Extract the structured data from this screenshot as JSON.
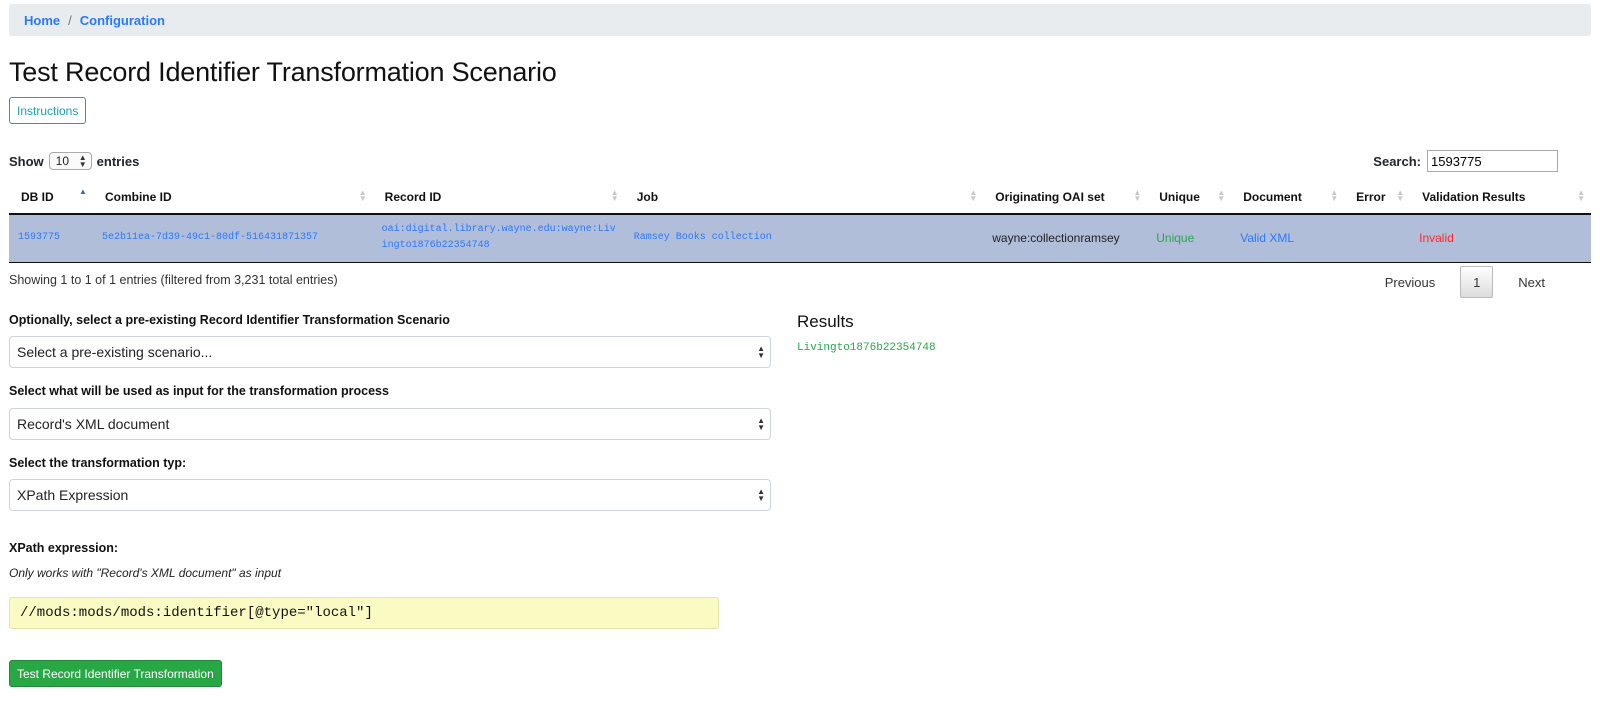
{
  "breadcrumb": {
    "items": [
      "Home",
      "Configuration"
    ],
    "separator": "/"
  },
  "page": {
    "title": "Test Record Identifier Transformation Scenario"
  },
  "instructions_button": "Instructions",
  "table_controls": {
    "show_label": "Show",
    "page_size": "10",
    "entries_label": "entries",
    "search_label": "Search:",
    "search_value": "1593775"
  },
  "table": {
    "columns": [
      "DB ID",
      "Combine ID",
      "Record ID",
      "Job",
      "Originating OAI set",
      "Unique",
      "Document",
      "Error",
      "Validation Results"
    ],
    "sorted_column": "DB ID",
    "rows": [
      {
        "db_id": "1593775",
        "combine_id": "5e2b11ea-7d39-49c1-80df-516431871357",
        "record_id_line1": "oai:digital.library.wayne.edu:wayne:Liv",
        "record_id_line2": "ingto1876b22354748",
        "job": "Ramsey Books collection",
        "oai_set": "wayne:collectionramsey",
        "unique": "Unique",
        "document": "Valid XML",
        "error": "",
        "validation": "Invalid"
      }
    ],
    "row_highlight_color": "#b0bed9"
  },
  "table_footer": {
    "info": "Showing 1 to 1 of 1 entries (filtered from 3,231 total entries)",
    "previous": "Previous",
    "current_page": "1",
    "next": "Next"
  },
  "form": {
    "scenario_label": "Optionally, select a pre-existing Record Identifier Transformation Scenario",
    "scenario_value": "Select a pre-existing scenario...",
    "input_label": "Select what will be used as input for the transformation process",
    "input_value": "Record's XML document",
    "type_label": "Select the transformation typ:",
    "type_value": "XPath Expression",
    "xpath_label": "XPath expression:",
    "xpath_help": "Only works with \"Record's XML document\" as input",
    "xpath_value": "//mods:mods/mods:identifier[@type=\"local\"]",
    "submit_label": "Test Record Identifier Transformation"
  },
  "results": {
    "title": "Results",
    "value": "Livingto1876b22354748"
  },
  "colors": {
    "link": "#2979ff",
    "success": "#28a745",
    "danger": "#ff2a2a",
    "info": "#17a2b8",
    "xpath_bg": "#fafbc2"
  }
}
